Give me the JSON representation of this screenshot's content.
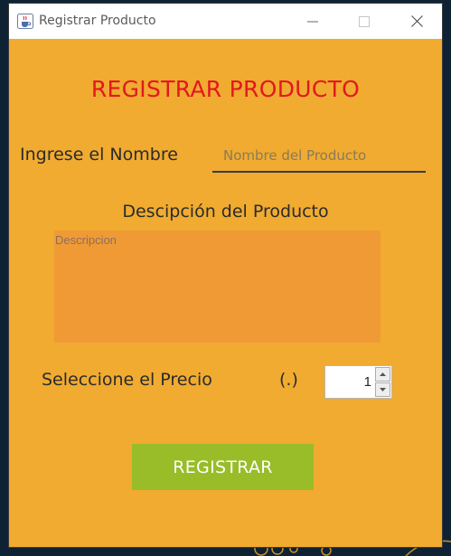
{
  "window": {
    "title": "Registrar Producto"
  },
  "form": {
    "heading": "REGISTRAR PRODUCTO",
    "name_label": "Ingrese el Nombre",
    "name_placeholder": "Nombre del Producto",
    "name_value": "",
    "description_label": "Descipción del Producto",
    "description_placeholder": "Descripcion",
    "description_value": "",
    "price_label": "Seleccione el Precio",
    "price_unit": "(.)",
    "price_value": "1",
    "submit_label": "REGISTRAR"
  },
  "icons": {
    "app": "java-coffee-icon",
    "minimize": "minimize-icon",
    "maximize": "maximize-icon",
    "close": "close-icon",
    "spin_up": "triangle-up-icon",
    "spin_down": "triangle-down-icon"
  },
  "colors": {
    "window_background": "#f0ab30",
    "heading": "#e3181f",
    "textarea_background": "#f09a36",
    "submit_button": "#98bd28"
  }
}
